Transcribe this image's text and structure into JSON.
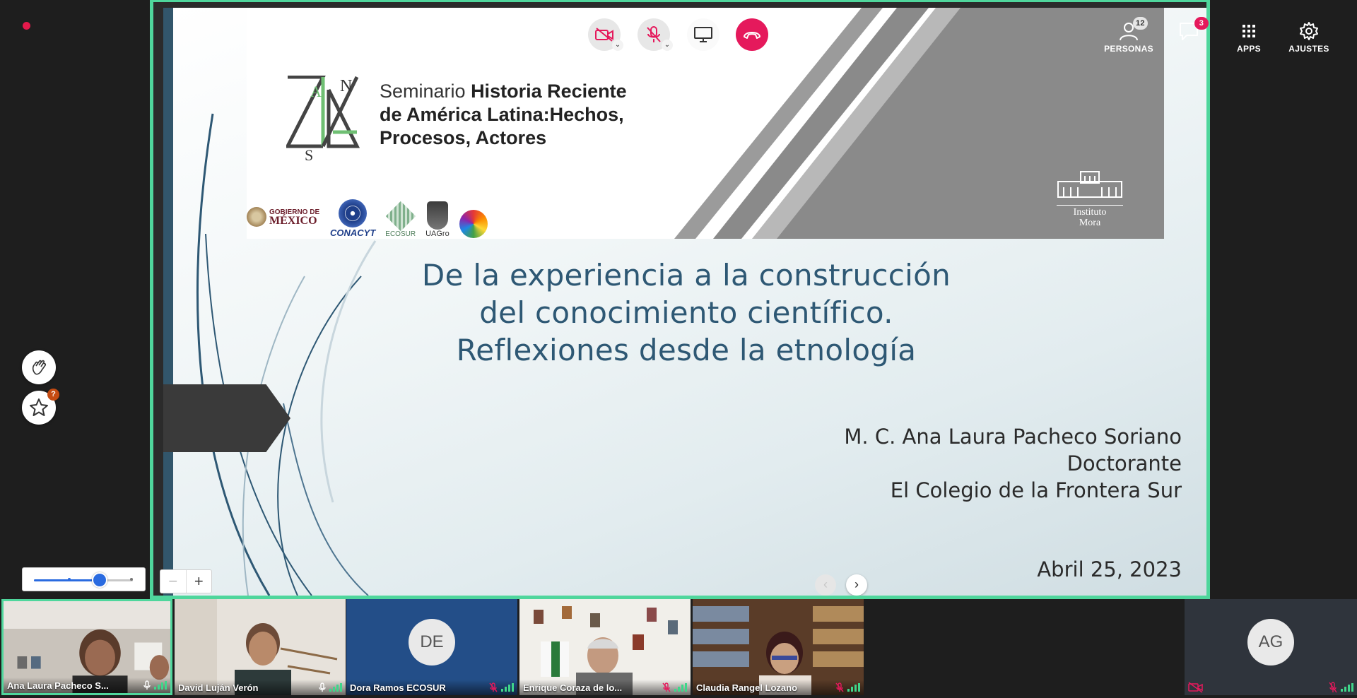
{
  "slide": {
    "seminar": {
      "line1_light": "Seminario ",
      "line1_bold": "Historia Reciente",
      "line2": "de América Latina:Hechos,",
      "line3": "Procesos, Actores"
    },
    "sponsors": {
      "gob_line1": "GOBIERNO DE",
      "gob_line2": "MÉXICO",
      "conacyt": "CONACYT",
      "ecosur": "ECOSUR",
      "uag": "UAGro"
    },
    "institute": {
      "line1": "Instituto",
      "line2": "Mora"
    },
    "title": [
      "De la experiencia a la construcción",
      "del conocimiento científico.",
      "Reflexiones desde la etnología"
    ],
    "author": [
      "M. C. Ana Laura Pacheco Soriano",
      "Doctorante",
      "El Colegio de la Frontera Sur"
    ],
    "date": "Abril 25, 2023"
  },
  "toolbar": {
    "people_label": "PERSONAS",
    "people_count": "12",
    "chat_count": "3",
    "apps_label": "APPS",
    "settings_label": "AJUSTES"
  },
  "floating": {
    "star_badge": "?"
  },
  "zoom": {
    "minus": "−",
    "plus": "+"
  },
  "slide_nav": {
    "prev": "‹",
    "next": "›"
  },
  "participants": [
    {
      "name": "Ana Laura Pacheco S...",
      "initials": "",
      "mic": "on"
    },
    {
      "name": "David Luján Verón",
      "initials": "",
      "mic": "on"
    },
    {
      "name": "Dora Ramos ECOSUR",
      "initials": "DE",
      "mic": "off"
    },
    {
      "name": "Enrique Coraza de lo...",
      "initials": "",
      "mic": "off"
    },
    {
      "name": "Claudia Rangel Lozano",
      "initials": "",
      "mic": "off"
    },
    {
      "name": "",
      "initials": "AG",
      "mic": "off"
    }
  ],
  "colors": {
    "accent": "#4fd69c",
    "hangup": "#e5195c",
    "title": "#2e5874"
  }
}
